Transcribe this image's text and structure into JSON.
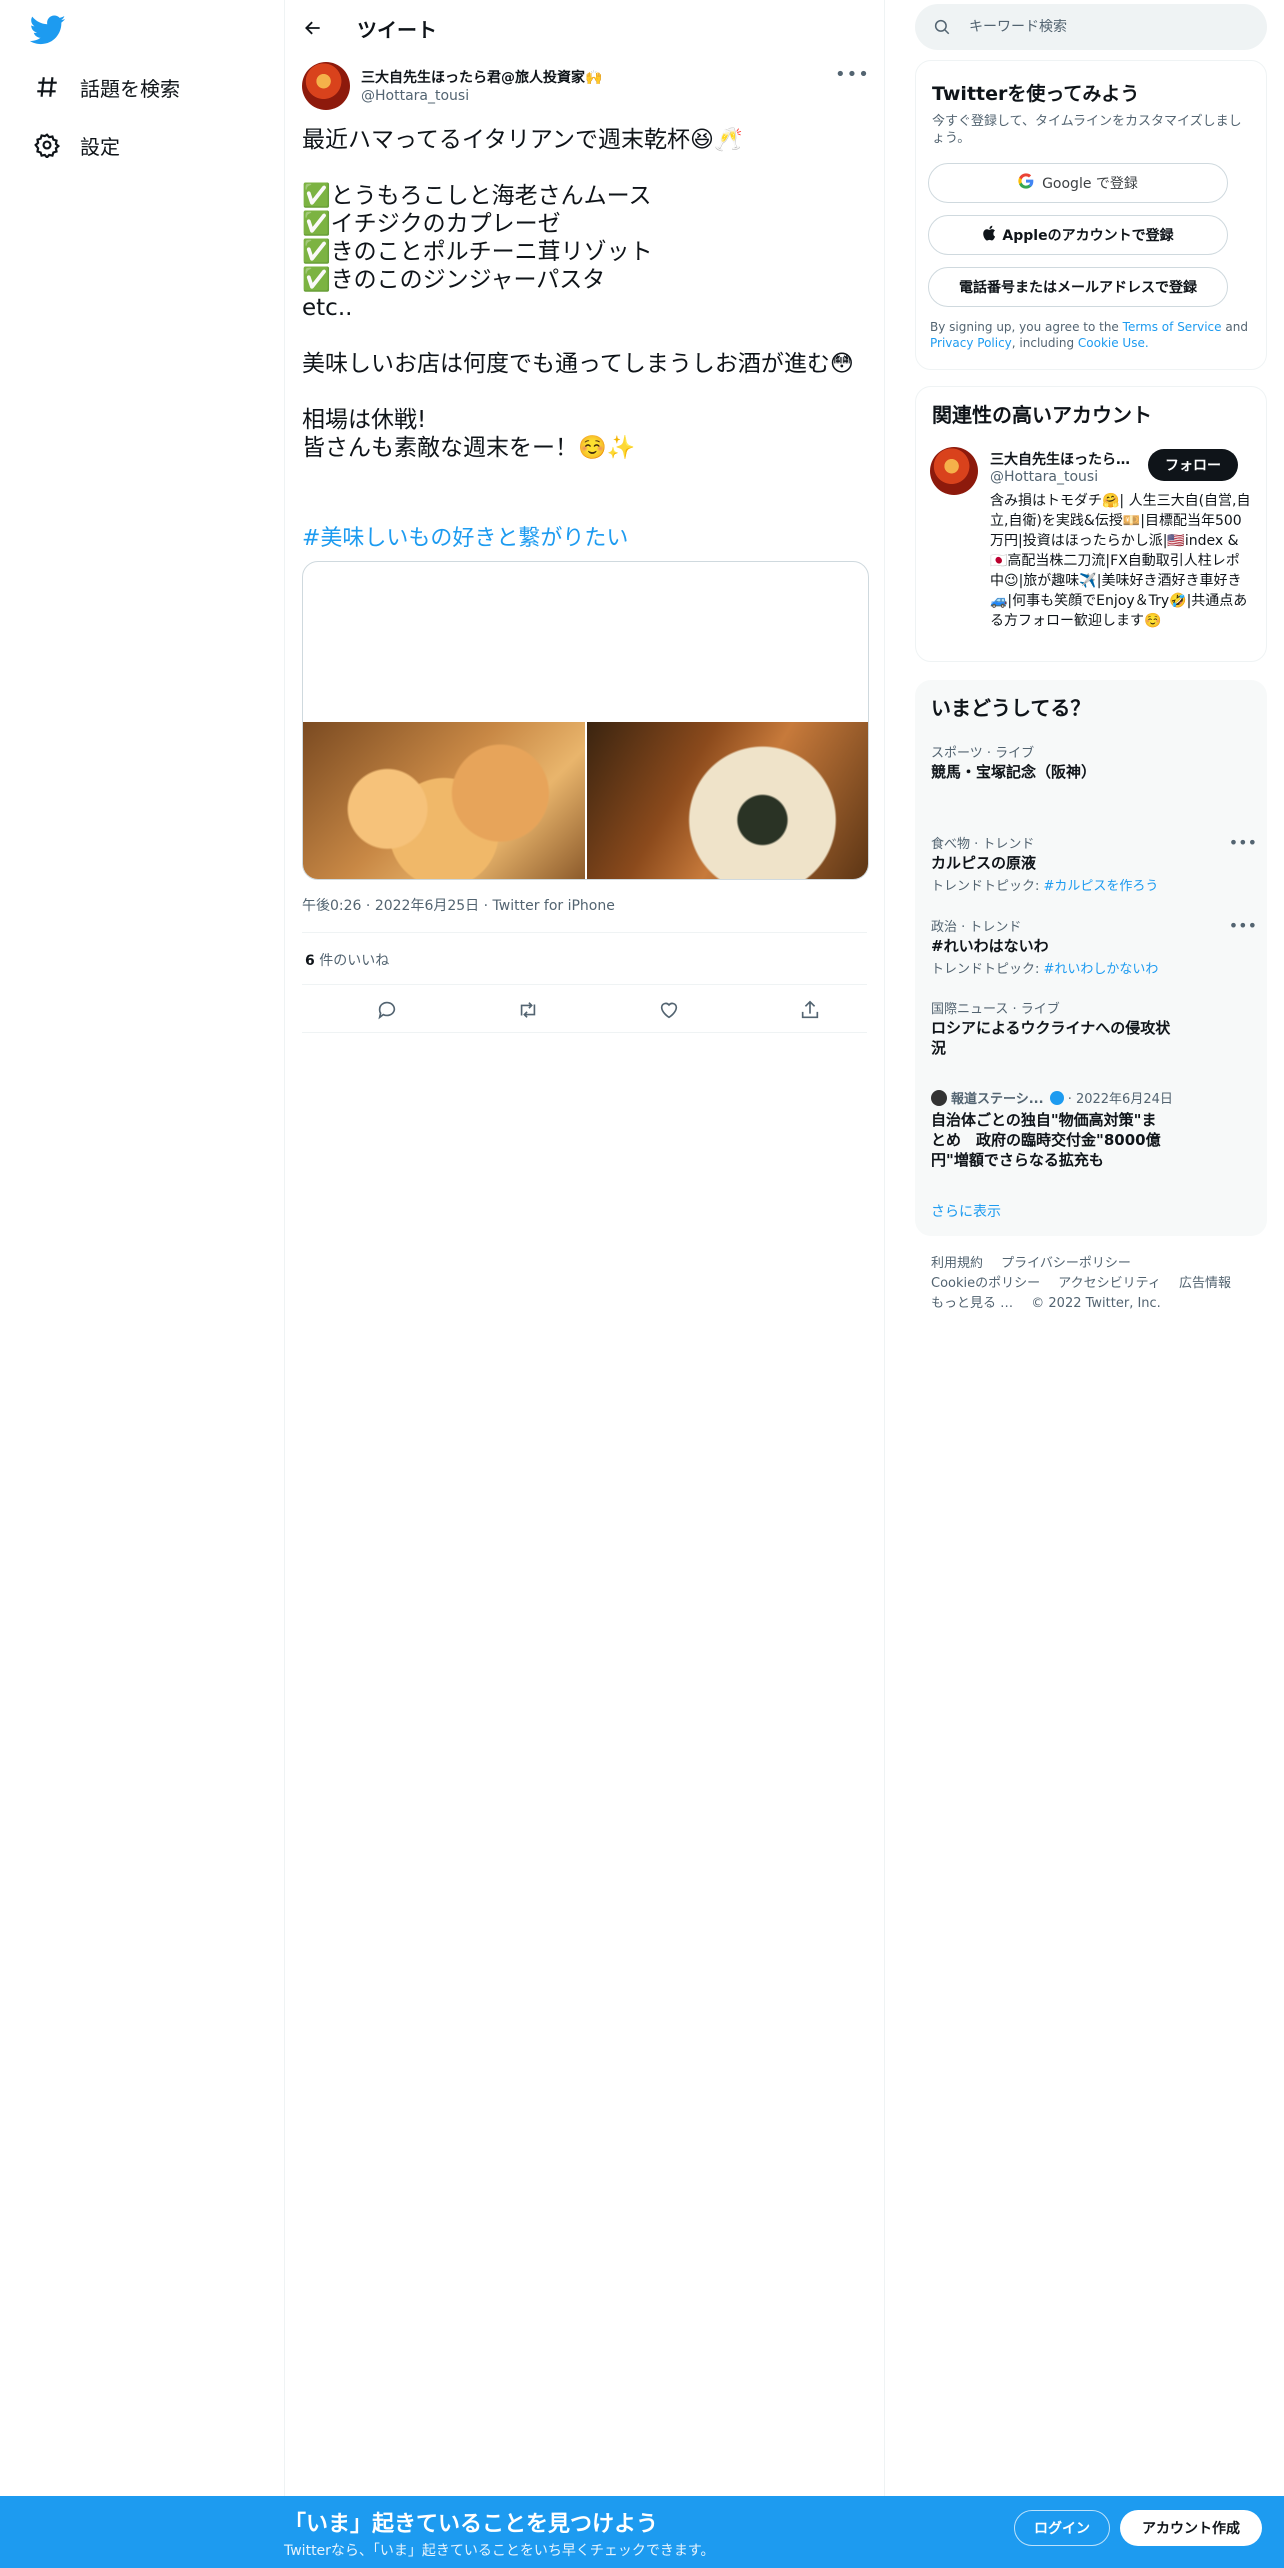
{
  "sidebar": {
    "items": [
      {
        "label": "話題を検索",
        "icon": "hashtag-icon"
      },
      {
        "label": "設定",
        "icon": "gear-icon"
      }
    ]
  },
  "header": {
    "title": "ツイート"
  },
  "tweet": {
    "author_name": "三大自先生ほったら君@旅人投資家🙌",
    "author_handle": "@Hottara_tousi",
    "text": "最近ハマってるイタリアンで週末乾杯😆🥂\n\n✅とうもろこしと海老さんムース\n✅イチジクのカプレーゼ\n✅きのことポルチーニ茸リゾット\n✅きのこのジンジャーパスタ\netc..\n\n美味しいお店は何度でも通ってしまうしお酒が進む😳\n\n相場は休戦!\n皆さんも素敵な週末をー！☺️✨",
    "hashtag": "#美味しいもの好きと繋がりたい",
    "time": "午後0:26",
    "date": "2022年6月25日",
    "source": "Twitter for iPhone",
    "likes_count": "6",
    "likes_label": "件のいいね"
  },
  "search": {
    "placeholder": "キーワード検索"
  },
  "signup": {
    "title": "Twitterを使ってみよう",
    "subtitle": "今すぐ登録して、タイムラインをカスタマイズしましょう。",
    "google": "Google で登録",
    "apple": "Appleのアカウントで登録",
    "phone": "電話番号またはメールアドレスで登録",
    "terms_pre": "By signing up, you agree to the",
    "terms_tos": "Terms of Service",
    "terms_and": "and",
    "terms_privacy": "Privacy Policy",
    "terms_including": ", including",
    "terms_cookie": "Cookie Use."
  },
  "related": {
    "title": "関連性の高いアカウント",
    "name": "三大自先生ほったら君@旅人投資家🙌",
    "handle": "@Hottara_tousi",
    "follow": "フォロー",
    "bio": "含み損はトモダチ🤗| 人生三大自(自営,自立,自衛)を実践&伝授💴|目標配当年500万円|投資はほったらかし派|🇺🇸index & 🇯🇵高配当株二刀流|FX自動取引人柱レポ中😉|旅が趣味✈️|美味好き酒好き車好き🚙|何事も笑顔でEnjoy＆Try🤣|共通点ある方フォロー歓迎します☺️"
  },
  "trends": {
    "title": "いまどうしてる？",
    "items": [
      {
        "context": "スポーツ · ライブ",
        "name": "競馬・宝塚記念（阪神）"
      },
      {
        "context": "食べ物 · トレンド",
        "name": "カルピスの原液",
        "topic_label": "トレンドトピック:",
        "topic_tag": "#カルピスを作ろう"
      },
      {
        "context": "政治 · トレンド",
        "name": "#れいわはないわ",
        "topic_label": "トレンドトピック:",
        "topic_tag": "#れいわしかないわ"
      },
      {
        "context": "国際ニュース · ライブ",
        "name": "ロシアによるウクライナへの侵攻状況"
      },
      {
        "context": "報道ステーシ...",
        "date": "· 2022年6月24日",
        "name": "自治体ごとの独自\"物価高対策\"まとめ　政府の臨時交付金\"8000億円\"増額でさらなる拡充も"
      }
    ],
    "show_more": "さらに表示"
  },
  "footer": {
    "links": [
      "利用規約",
      "プライバシーポリシー",
      "Cookieのポリシー",
      "アクセシビリティ",
      "広告情報",
      "もっと見る …"
    ],
    "copyright": "© 2022 Twitter, Inc."
  },
  "bottom_bar": {
    "title": "「いま」起きていることを見つけよう",
    "subtitle": "Twitterなら、「いま」起きていることをいち早くチェックできます。",
    "login": "ログイン",
    "signup": "アカウント作成"
  },
  "colors": {
    "accent": "#1d9bf0",
    "text": "#0f1419",
    "muted": "#536471"
  }
}
